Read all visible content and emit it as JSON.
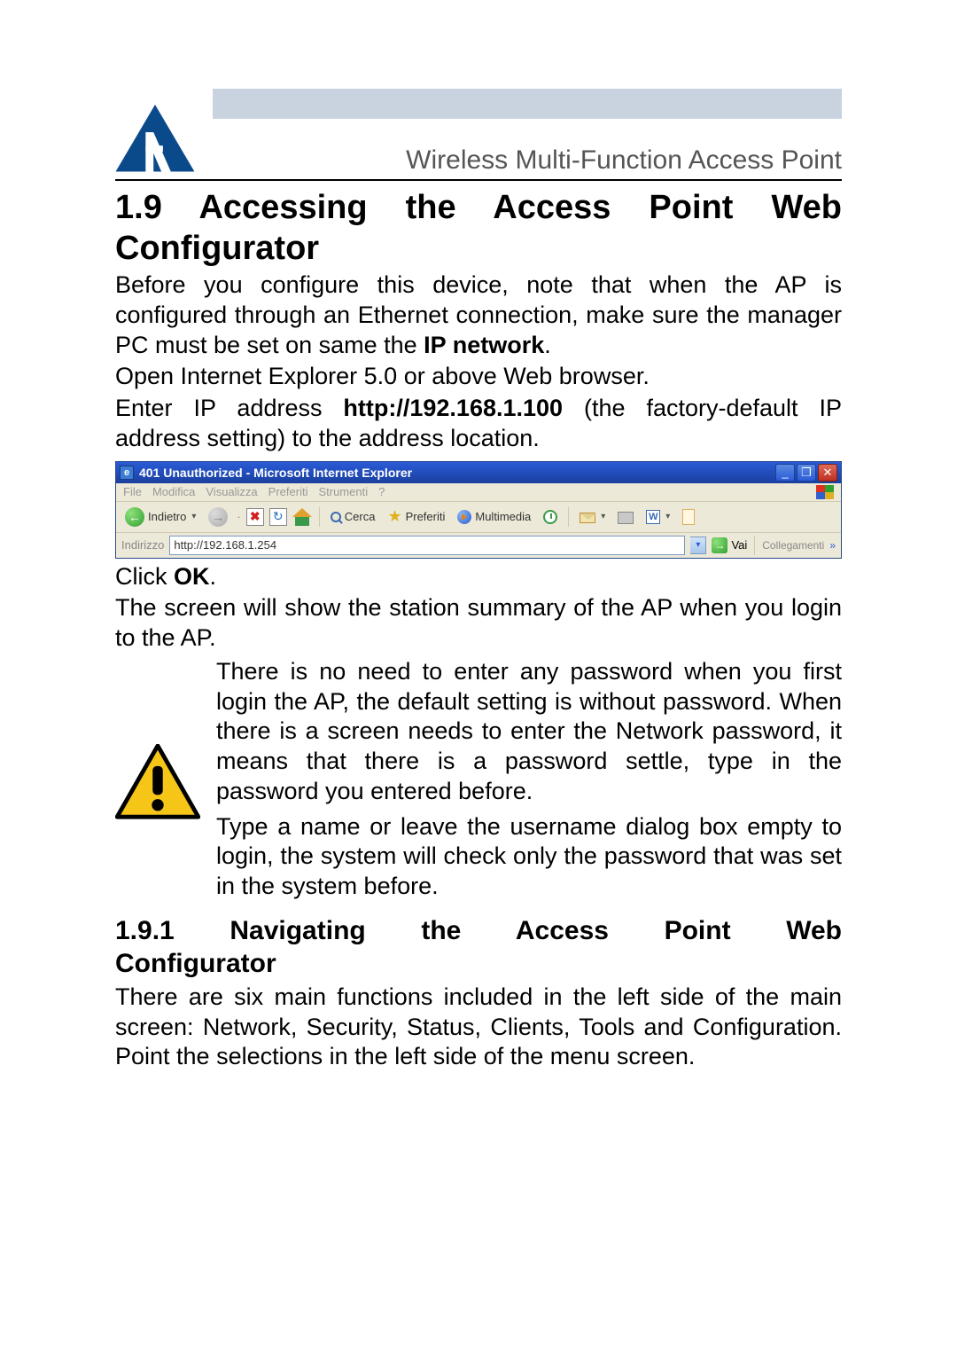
{
  "header": {
    "subtitle": "Wireless Multi-Function Access Point"
  },
  "section": {
    "heading_line1": "1.9  Accessing  the  Access  Point  Web",
    "heading_line2": "Configurator",
    "para1_pre": "Before you configure this device, note that when the AP is configured through an Ethernet connection, make sure the manager PC must be set on same the ",
    "para1_bold": "IP network",
    "para1_post": ".",
    "para2": "Open Internet Explorer 5.0 or above Web browser.",
    "para3_pre": "Enter IP address ",
    "para3_bold": "http://192.168.1.100",
    "para3_post": " (the factory-default IP address setting) to the address location.",
    "click_pre": "Click ",
    "click_bold": "OK",
    "click_post": ".",
    "after_click": "The screen will show the station summary of the AP when you login to the AP."
  },
  "ie": {
    "title": "401 Unauthorized - Microsoft Internet Explorer",
    "menus": [
      "File",
      "Modifica",
      "Visualizza",
      "Preferiti",
      "Strumenti",
      "?"
    ],
    "back": "Indietro",
    "search": "Cerca",
    "favorites": "Preferiti",
    "multimedia": "Multimedia",
    "addr_label": "Indirizzo",
    "addr_value": "http://192.168.1.254",
    "go": "Vai",
    "links": "Collegamenti"
  },
  "warn": {
    "p1": "There is no need to enter any password when you first login the AP, the default setting is without password. When there is a screen needs to enter the Network password, it means that there is a password settle, type in the password you entered before.",
    "p2": "Type a name or leave the username dialog box empty to login, the system will check only the password that was set in the system before."
  },
  "subsection": {
    "heading_l1": "1.9.1   Navigating   the   Access   Point   Web",
    "heading_l2": "Configurator",
    "para": "There are six main functions included in the left side of the main screen: Network, Security, Status, Clients, Tools and Configuration. Point the selections in the left side of the menu screen."
  }
}
